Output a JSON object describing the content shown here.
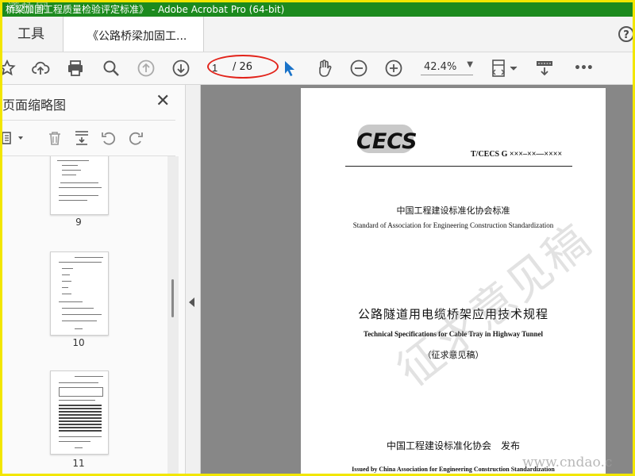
{
  "window": {
    "title": "桥梁加固工程质量检验评定标准》 - Adobe Acrobat Pro (64-bit)",
    "watermark_top": "道桥网"
  },
  "tabs": {
    "tools_label": "工具",
    "doc_tab_label": "《公路桥梁加固工...",
    "close_glyph": "×",
    "help_glyph": "?"
  },
  "toolbar": {
    "page_current": "1",
    "page_total": "/ 26",
    "zoom": "42.4%",
    "more_glyph": "•••"
  },
  "panel": {
    "title": "页面缩略图",
    "close_glyph": "✕",
    "thumbnails": [
      {
        "num": "9"
      },
      {
        "num": "10"
      },
      {
        "num": "11"
      }
    ]
  },
  "document": {
    "logo_text": "CECS",
    "standard_code": "T/CECS G ×××–××—××××",
    "association_cn": "中国工程建设标准化协会标准",
    "association_en": "Standard of Association for Engineering Construction Standardization",
    "title_cn": "公路隧道用电缆桥架应用技术规程",
    "title_en": "Technical Specifications for Cable Tray in Highway Tunnel",
    "draft_note": "（征求意见稿）",
    "publisher": "中国工程建设标准化协会　发布",
    "issued_by": "Issued by China Association for Engineering Construction Standardization",
    "stamp_text": "征求意见稿"
  },
  "site_watermark": "www.cndao.c",
  "colors": {
    "title_bar": "#1c8a1e",
    "frame": "#f2e600",
    "annotation_ellipse": "#e2231a",
    "doc_background": "#878787"
  }
}
